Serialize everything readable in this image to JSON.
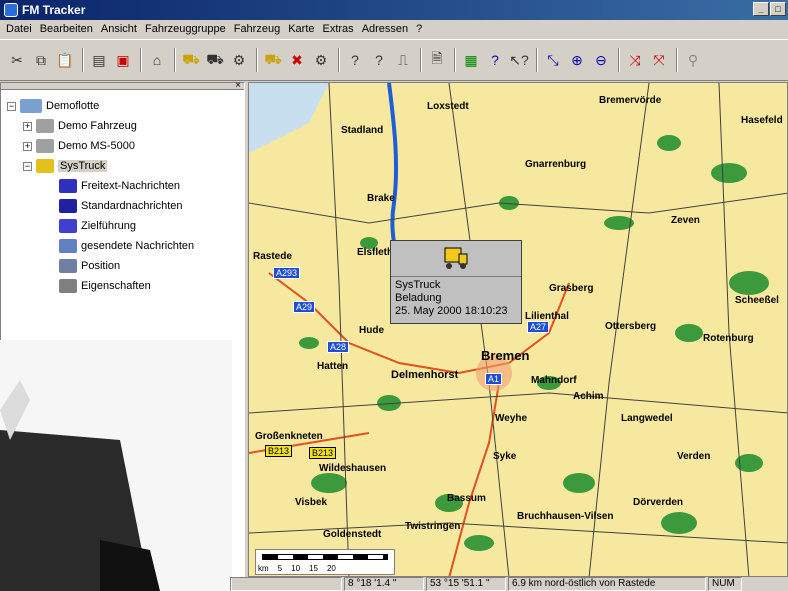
{
  "window": {
    "title": "FM Tracker"
  },
  "menu": [
    "Datei",
    "Bearbeiten",
    "Ansicht",
    "Fahrzeuggruppe",
    "Fahrzeug",
    "Karte",
    "Extras",
    "Adressen",
    "?"
  ],
  "tree": {
    "root": "Demoflotte",
    "vehicles": [
      {
        "label": "Demo Fahrzeug"
      },
      {
        "label": "Demo MS-5000"
      },
      {
        "label": "SysTruck"
      }
    ],
    "children": [
      {
        "label": "Freitext-Nachrichten",
        "icon": "freetext-message-icon",
        "color": "#3030c0"
      },
      {
        "label": "Standardnachrichten",
        "icon": "standard-message-icon",
        "color": "#2020a0"
      },
      {
        "label": "Zielführung",
        "icon": "navigation-icon",
        "color": "#4040d0"
      },
      {
        "label": "gesendete Nachrichten",
        "icon": "sent-messages-icon",
        "color": "#6080c0"
      },
      {
        "label": "Position",
        "icon": "position-icon",
        "color": "#7080a0"
      },
      {
        "label": "Eigenschaften",
        "icon": "properties-icon",
        "color": "#808080"
      }
    ]
  },
  "map": {
    "cities": [
      "Loxstedt",
      "Bremervörde",
      "Hasefeld",
      "Stadland",
      "Gnarrenburg",
      "Brake",
      "Zeven",
      "Rastede",
      "Elsfleth",
      "Lilienthal",
      "Grasberg",
      "Scheeßel",
      "Hude",
      "Ottersberg",
      "Rotenburg",
      "Hatten",
      "Delmenhorst",
      "Bremen",
      "Mahndorf",
      "Achim",
      "Langwedel",
      "Weyhe",
      "Großenkneten",
      "Wildeshausen",
      "Syke",
      "Verden",
      "Visbek",
      "Bassum",
      "Dörverden",
      "Goldenstedt",
      "Twistringen",
      "Bruchhausen-Vilsen"
    ],
    "roads": [
      "A293",
      "A29",
      "A28",
      "A27",
      "A1",
      "B213",
      "B213"
    ],
    "scale": {
      "unit": "km",
      "ticks": [
        "5",
        "10",
        "15",
        "20"
      ]
    }
  },
  "popup": {
    "name": "SysTruck",
    "status": "Beladung",
    "timestamp": "25. May 2000 18:10:23"
  },
  "status": {
    "lon": "8 °18 '1.4 \"",
    "lat": "53 °15 '51.1 \"",
    "location": "6.9 km nord-östlich von Rastede",
    "num": "NUM"
  },
  "colors": {
    "titlebar": "#0a246a",
    "map_land": "#f7e8a0",
    "forest": "#3c9a3c",
    "water": "#1e5ed6"
  }
}
